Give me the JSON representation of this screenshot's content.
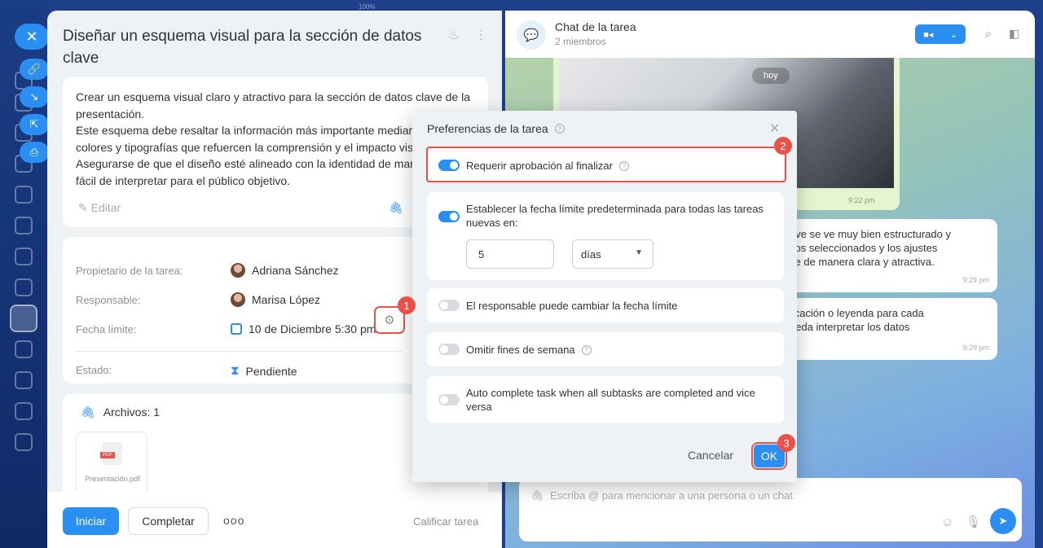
{
  "top_zoom": "100%",
  "task": {
    "title": "Diseñar un esquema visual para la sección de datos clave",
    "description": "Crear un esquema visual claro y atractivo para la sección de datos clave de la presentación.\nEste esquema debe resaltar la información más importante mediar\ncolores y tipografías que refuercen la comprensión y el impacto vis\nAsegurarse de que el diseño esté alineado con la identidad de mar\nfácil de interpretar para el público objetivo.",
    "edit_label": "Editar",
    "fields": {
      "owner_label": "Propietario de la tarea:",
      "owner_value": "Adriana Sánchez",
      "responsible_label": "Responsable:",
      "responsible_value": "Marisa López",
      "deadline_label": "Fecha límite:",
      "deadline_value": "10 de Diciembre 5:30 pm",
      "status_label": "Estado:",
      "status_value": "Pendiente"
    },
    "files": {
      "title": "Archivos: 1",
      "file_badge": "PDF",
      "file_name": "Presentación.pdf"
    },
    "footer": {
      "start_label": "Iniciar",
      "complete_label": "Completar",
      "more_label": "ooo",
      "rate_label": "Calificar tarea"
    }
  },
  "chat": {
    "title": "Chat de la tarea",
    "members": "2 miembros",
    "date_chip": "hoy",
    "photo_time": "9:22 pm",
    "messages": [
      {
        "text": "ave se ve muy bien estructurado y\ncos seleccionados y los ajustes\nve de manera clara y atractiva.",
        "time": "9:29 pm"
      },
      {
        "text": "licación o leyenda para cada\nueda interpretar los datos",
        "time": "9:29 pm"
      }
    ],
    "composer_placeholder": "Escriba @ para mencionar a una persona o un chat"
  },
  "dialog": {
    "title": "Preferencias de la tarea",
    "options": [
      {
        "label": "Requerir aprobación al finalizar",
        "enabled": true
      },
      {
        "label": "Establecer la fecha límite predeterminada para todas las tareas nuevas en:",
        "enabled": true
      },
      {
        "label": "El responsable puede cambiar la fecha límite",
        "enabled": false
      },
      {
        "label": "Omitir fines de semana",
        "enabled": false
      },
      {
        "label": "Auto complete task when all subtasks are completed and vice versa",
        "enabled": false
      }
    ],
    "deadline_amount": "5",
    "deadline_unit": "días",
    "cancel_label": "Cancelar",
    "ok_label": "OK"
  },
  "steps": [
    "1",
    "2",
    "3"
  ],
  "colors": {
    "accent": "#2b8ef1",
    "highlight": "#e9524a",
    "rail": "#1b3d86"
  }
}
